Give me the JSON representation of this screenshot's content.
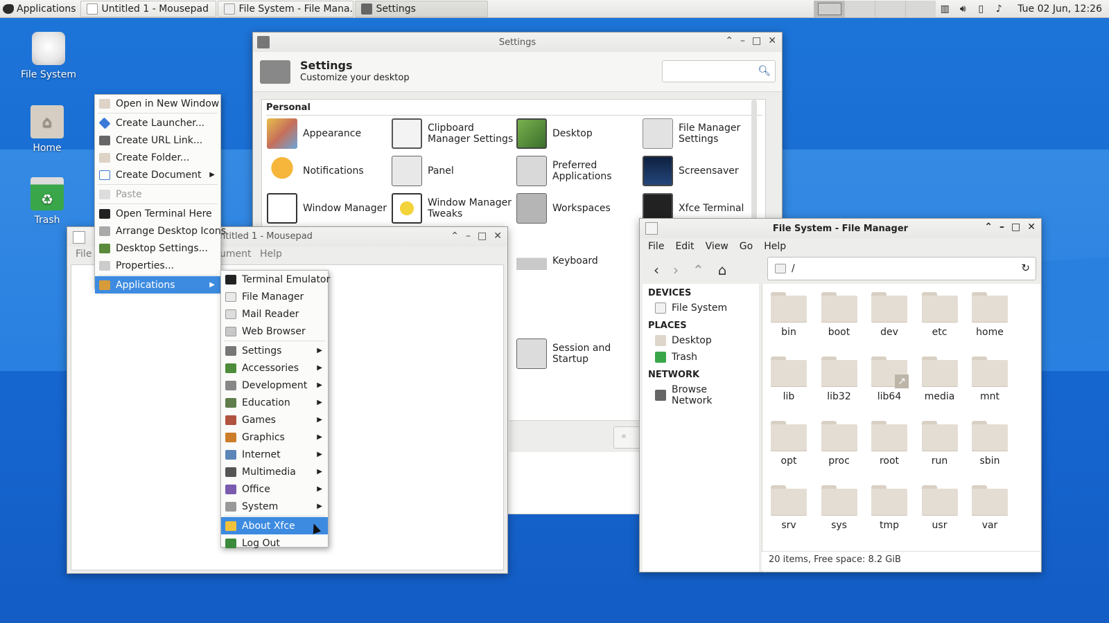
{
  "panel": {
    "apps_label": "Applications",
    "tasks": [
      {
        "label": "Untitled 1 - Mousepad",
        "icon": "text-editor-icon"
      },
      {
        "label": "File System - File Mana...",
        "icon": "file-manager-icon"
      },
      {
        "label": "Settings",
        "icon": "settings-icon"
      }
    ],
    "clock": "Tue 02 Jun, 12:26"
  },
  "desktop": {
    "icons": [
      {
        "label": "File System",
        "icon": "drive-icon"
      },
      {
        "label": "Home",
        "icon": "home-folder-icon"
      },
      {
        "label": "Trash",
        "icon": "trash-icon"
      }
    ]
  },
  "context_menu": {
    "items": [
      {
        "label": "Open in New Window"
      },
      {
        "label": "Create Launcher..."
      },
      {
        "label": "Create URL Link..."
      },
      {
        "label": "Create Folder..."
      },
      {
        "label": "Create Document"
      },
      {
        "label": "Paste"
      },
      {
        "label": "Open Terminal Here"
      },
      {
        "label": "Arrange Desktop Icons"
      },
      {
        "label": "Desktop Settings..."
      },
      {
        "label": "Properties..."
      },
      {
        "label": "Applications"
      }
    ]
  },
  "apps_menu": {
    "items": [
      {
        "label": "Terminal Emulator"
      },
      {
        "label": "File Manager"
      },
      {
        "label": "Mail Reader"
      },
      {
        "label": "Web Browser"
      },
      {
        "label": "Settings"
      },
      {
        "label": "Accessories"
      },
      {
        "label": "Development"
      },
      {
        "label": "Education"
      },
      {
        "label": "Games"
      },
      {
        "label": "Graphics"
      },
      {
        "label": "Internet"
      },
      {
        "label": "Multimedia"
      },
      {
        "label": "Office"
      },
      {
        "label": "System"
      },
      {
        "label": "About Xfce"
      },
      {
        "label": "Log Out"
      }
    ]
  },
  "settings": {
    "window_title": "Settings",
    "title": "Settings",
    "subtitle": "Customize your desktop",
    "search_placeholder": "",
    "category": "Personal",
    "items": [
      {
        "label": "Appearance"
      },
      {
        "label": "Clipboard Manager Settings"
      },
      {
        "label": "Desktop"
      },
      {
        "label": "File Manager Settings"
      },
      {
        "label": "Notifications"
      },
      {
        "label": "Panel"
      },
      {
        "label": "Preferred Applications"
      },
      {
        "label": "Screensaver"
      },
      {
        "label": "Window Manager"
      },
      {
        "label": "Window Manager Tweaks"
      },
      {
        "label": "Workspaces"
      },
      {
        "label": "Xfce Terminal"
      },
      {
        "label": "Keyboard"
      },
      {
        "label": "Session and Startup"
      }
    ]
  },
  "mousepad": {
    "window_title": "Untitled 1 - Mousepad",
    "title_visible": "ntitled 1 - Mousepad",
    "menu_file": "File",
    "menu_document_partial": "ument",
    "menu_help": "Help"
  },
  "filemanager": {
    "window_title": "File System - File Manager",
    "menus": [
      "File",
      "Edit",
      "View",
      "Go",
      "Help"
    ],
    "location": "/",
    "sections": {
      "devices": "DEVICES",
      "places": "PLACES",
      "network": "NETWORK"
    },
    "devices": [
      "File System"
    ],
    "places": [
      "Desktop",
      "Trash"
    ],
    "network": [
      "Browse Network"
    ],
    "folders": [
      "bin",
      "boot",
      "dev",
      "etc",
      "home",
      "lib",
      "lib32",
      "lib64",
      "media",
      "mnt",
      "opt",
      "proc",
      "root",
      "run",
      "sbin",
      "srv",
      "sys",
      "tmp",
      "usr",
      "var"
    ],
    "status": "20 items, Free space: 8.2 GiB"
  },
  "colors": {
    "desktop_bg": "#1a6fd6",
    "menu_selection": "#3d8be0",
    "folder": "#e4ddd3"
  }
}
